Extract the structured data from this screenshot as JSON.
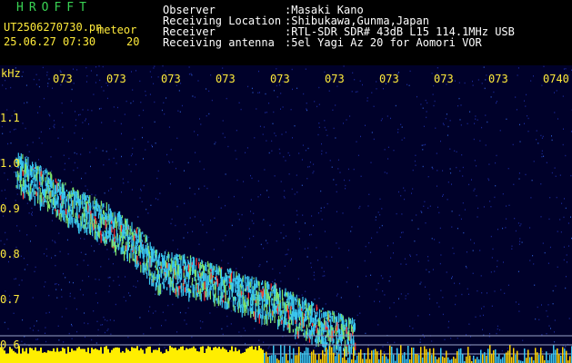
{
  "header": {
    "logo": "HROFFT",
    "file_name": "UT2506270730.pn",
    "mode_label": "meteor",
    "date_time": "25.06.27 07:30",
    "gain": "20",
    "observer_label": "Observer",
    "observer_value": ":Masaki Kano",
    "location_label": "Receiving Location",
    "location_value": ":Shibukawa,Gunma,Japan",
    "receiver_label": "Receiver",
    "receiver_value": ":RTL-SDR SDR# 43dB L15 114.1MHz USB",
    "antenna_label": "Receiving antenna",
    "antenna_value": ":5el Yagi Az 20 for Aomori VOR"
  },
  "axis": {
    "unit": "kHz",
    "y_labels": [
      "1.1",
      "1.0",
      "0.9",
      "0.8",
      "0.7",
      "0.6"
    ],
    "x_labels": [
      "073",
      "073",
      "073",
      "073",
      "073",
      "073",
      "073",
      "073",
      "073",
      "0740"
    ]
  },
  "chart_data": {
    "type": "heatmap",
    "ylabel": "kHz",
    "y_ticks": [
      1.1,
      1.0,
      0.9,
      0.8,
      0.7,
      0.6
    ],
    "x_ticks": [
      "073",
      "073",
      "073",
      "073",
      "073",
      "073",
      "073",
      "073",
      "073",
      "0740"
    ],
    "series": [
      {
        "points": [
          [
            0.0,
            0.99
          ],
          [
            0.05,
            0.95
          ],
          [
            0.1,
            0.91
          ],
          [
            0.15,
            0.88
          ],
          [
            0.2,
            0.84
          ],
          [
            0.25,
            0.77
          ],
          [
            0.3,
            0.76
          ],
          [
            0.35,
            0.74
          ],
          [
            0.4,
            0.72
          ],
          [
            0.45,
            0.7
          ],
          [
            0.5,
            0.67
          ],
          [
            0.55,
            0.64
          ],
          [
            0.6,
            0.62
          ]
        ]
      }
    ],
    "colors": {
      "background": "#00012a",
      "signal": "#39c6f0",
      "strong": "#ff3030",
      "base_band": "#ffee00",
      "text": "#ffeb3b"
    }
  }
}
